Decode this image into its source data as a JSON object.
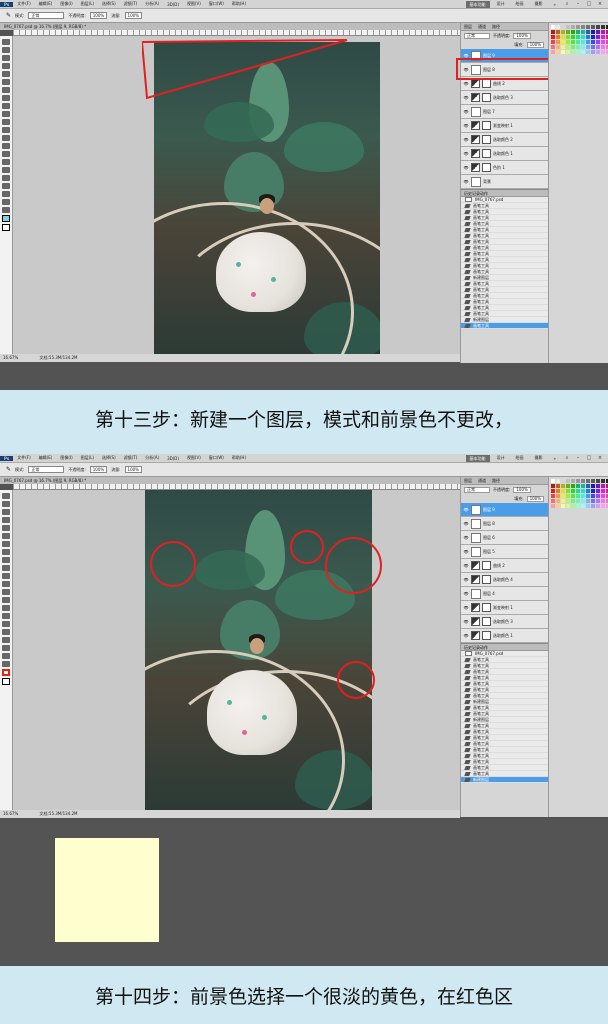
{
  "menu": [
    "文件(F)",
    "编辑(E)",
    "图像(I)",
    "图层(L)",
    "选择(S)",
    "滤镜(T)",
    "分析(A)",
    "3D(D)",
    "视图(V)",
    "窗口(W)",
    "帮助(H)"
  ],
  "workspace": {
    "essentials": "基本功能",
    "items": [
      "设计",
      "绘画",
      "摄影",
      "»"
    ],
    "search_icon": "search-icon"
  },
  "options": {
    "mode_label": "模式:",
    "mode_value": "正常",
    "opacity_label": "不透明度:",
    "opacity_value": "100%",
    "flow_label": "流量:",
    "flow_value": "100%"
  },
  "doc_tab": "IMG_0767.psd @ 16.7% (图层 9, RGB/8) *",
  "status": {
    "zoom": "16.67%",
    "doc": "文档:55.3M/134.2M"
  },
  "layers_panel": {
    "tabs": [
      "图层",
      "通道",
      "路径"
    ],
    "blend": "正常",
    "opacity_label": "不透明度:",
    "opacity_value": "100%",
    "fill_label": "填充:",
    "fill_value": "100%",
    "layers_top": [
      {
        "name": "图层 9",
        "type": "pixel",
        "selected": true
      },
      {
        "name": "图层 8",
        "type": "pixel"
      },
      {
        "name": "曲线 2",
        "type": "adjust"
      },
      {
        "name": "选取颜色 3",
        "type": "adjust"
      },
      {
        "name": "图层 7",
        "type": "pixel"
      },
      {
        "name": "渐变映射 1",
        "type": "adjust"
      },
      {
        "name": "选取颜色 2",
        "type": "adjust"
      },
      {
        "name": "选取颜色 1",
        "type": "adjust"
      },
      {
        "name": "色阶 1",
        "type": "adjust"
      },
      {
        "name": "背景",
        "type": "pixel"
      }
    ],
    "layers_bottom": [
      {
        "name": "图层 9",
        "type": "pixel",
        "selected": true
      },
      {
        "name": "图层 8",
        "type": "pixel"
      },
      {
        "name": "图层 6",
        "type": "pixel"
      },
      {
        "name": "图层 5",
        "type": "pixel"
      },
      {
        "name": "曲线 2",
        "type": "adjust"
      },
      {
        "name": "选取颜色 4",
        "type": "adjust"
      },
      {
        "name": "图层 4",
        "type": "pixel"
      },
      {
        "name": "渐变映射 1",
        "type": "adjust"
      },
      {
        "name": "选取颜色 3",
        "type": "adjust"
      },
      {
        "name": "选取颜色 1",
        "type": "adjust"
      }
    ]
  },
  "history_panel": {
    "tabs": [
      "历史记录",
      "动作"
    ],
    "snapshot": "IMG_0767.psd",
    "items_top": [
      "画笔工具",
      "画笔工具",
      "画笔工具",
      "画笔工具",
      "画笔工具",
      "画笔工具",
      "画笔工具",
      "画笔工具",
      "画笔工具",
      "画笔工具",
      "画笔工具",
      "画笔工具",
      "新建图层",
      "画笔工具",
      "画笔工具",
      "画笔工具",
      "画笔工具",
      "画笔工具",
      "画笔工具",
      "新建图层",
      "画笔工具"
    ],
    "items_bottom": [
      "画笔工具",
      "画笔工具",
      "画笔工具",
      "画笔工具",
      "画笔工具",
      "画笔工具",
      "画笔工具",
      "新建图层",
      "画笔工具",
      "画笔工具",
      "新建图层",
      "画笔工具",
      "画笔工具",
      "画笔工具",
      "画笔工具",
      "画笔工具",
      "画笔工具",
      "画笔工具",
      "画笔工具",
      "画笔工具",
      "新建图层"
    ]
  },
  "captions": {
    "step13": "第十三步：新建一个图层，模式和前景色不更改，",
    "step14": "第十四步：前景色选择一个很淡的黄色，在红色区"
  },
  "colors": {
    "highlight": "#e12020",
    "selected_layer": "#4a9de6",
    "pale_yellow": "#fffecf",
    "page_bg": "#cfe8f2"
  }
}
